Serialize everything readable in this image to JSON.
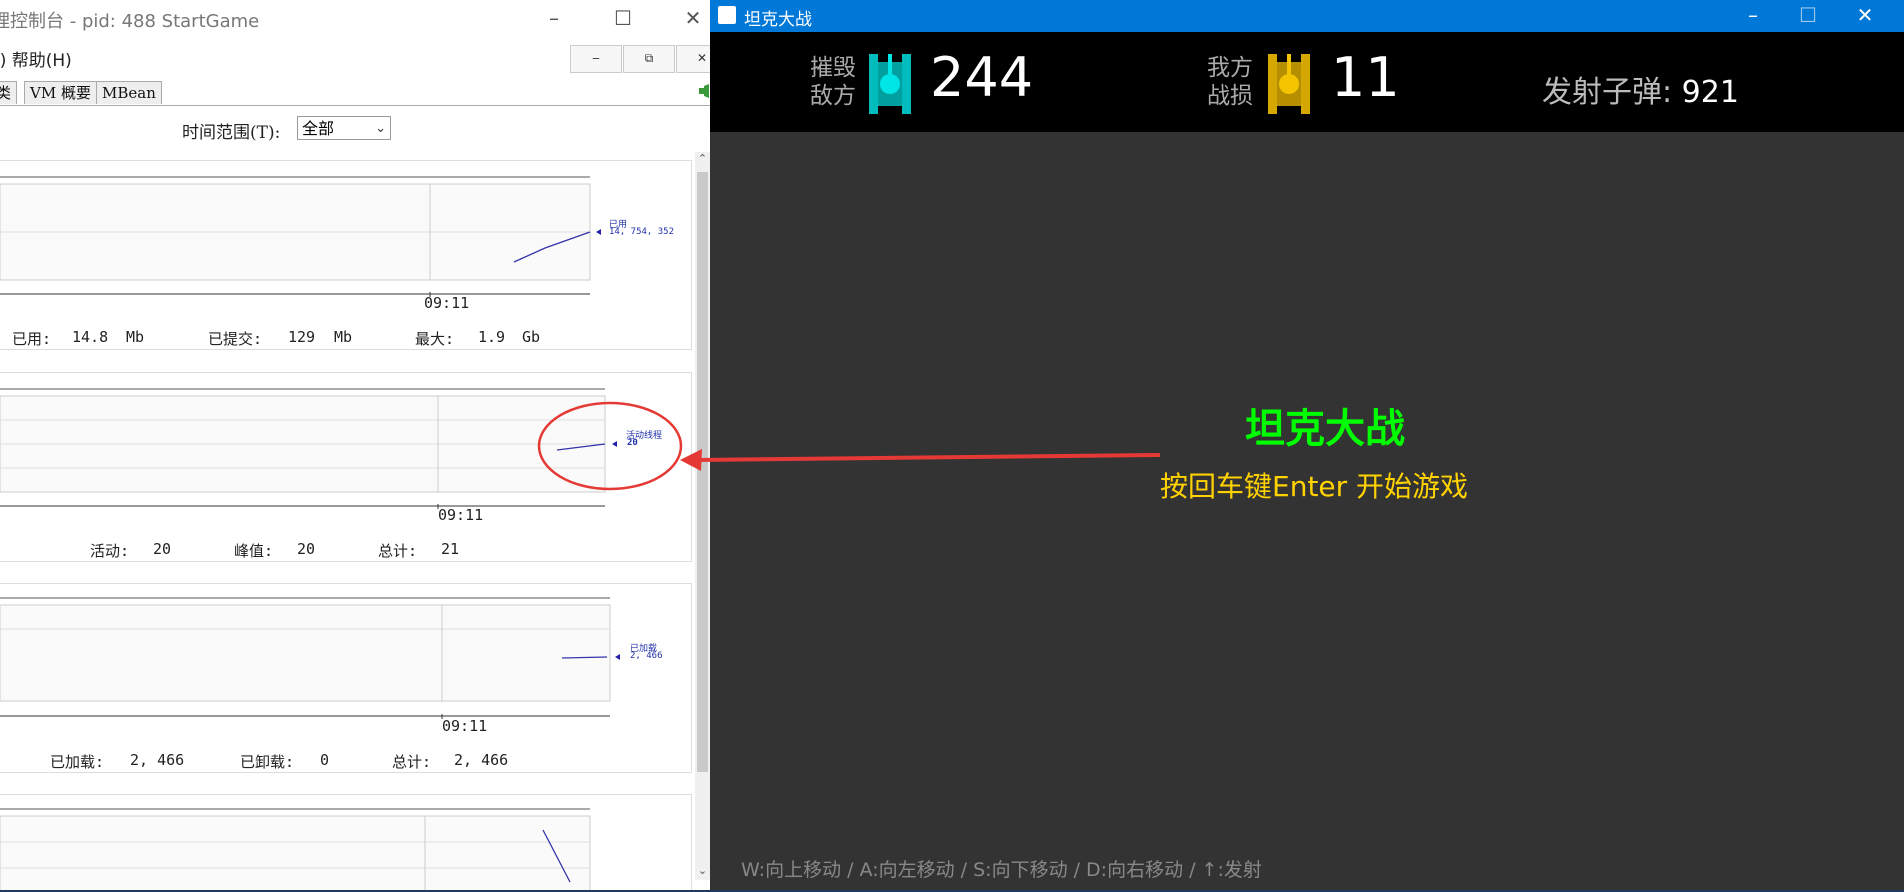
{
  "jconsole": {
    "title": "理控制台 - pid: 488 StartGame",
    "menu": "/) 帮助(H)",
    "inner_buttons": [
      "‒",
      "⧉",
      "✕"
    ],
    "tabs": [
      "类",
      "VM 概要",
      "MBean"
    ],
    "time_range_label": "时间范围(T):",
    "time_range_value": "全部",
    "chart_time_label": "09:11",
    "heap": {
      "legend_name": "已用",
      "legend_value": "14, 754, 352",
      "stats": [
        {
          "label": "已用:",
          "value": "14.8",
          "unit": "Mb"
        },
        {
          "label": "已提交:",
          "value": "129",
          "unit": "Mb"
        },
        {
          "label": "最大:",
          "value": "1.9",
          "unit": "Gb"
        }
      ]
    },
    "threads": {
      "legend_name": "活动线程",
      "legend_value": "20",
      "stats": [
        {
          "label": "活动:",
          "value": "20"
        },
        {
          "label": "峰值:",
          "value": "20"
        },
        {
          "label": "总计:",
          "value": "21"
        }
      ]
    },
    "classes": {
      "legend_name": "已加载",
      "legend_value": "2, 466",
      "stats": [
        {
          "label": "已加载:",
          "value": "2, 466"
        },
        {
          "label": "已卸载:",
          "value": "0"
        },
        {
          "label": "总计:",
          "value": "2, 466"
        }
      ]
    }
  },
  "tank": {
    "title": "坦克大战",
    "destroyed_label_1": "摧毁",
    "destroyed_label_2": "敌方",
    "destroyed_value": "244",
    "loss_label_1": "我方",
    "loss_label_2": "战损",
    "loss_value": "11",
    "bullets_label": "发射子弹: ",
    "bullets_value": "921",
    "game_title": "坦克大战",
    "start_hint": "按回车键Enter 开始游戏",
    "controls": "W:向上移动 / A:向左移动 / S:向下移动 / D:向右移动 / ↑:发射",
    "colors": {
      "titlebar": "#0078d7",
      "hud": "#000000",
      "background": "#333333",
      "enemy_tank": "#00cccc",
      "player_tank": "#e6b800",
      "game_title": "#00ff00",
      "hint": "#ffd200"
    }
  },
  "annotation": {
    "circle_color": "#e53935",
    "arrow_color": "#e53935"
  }
}
